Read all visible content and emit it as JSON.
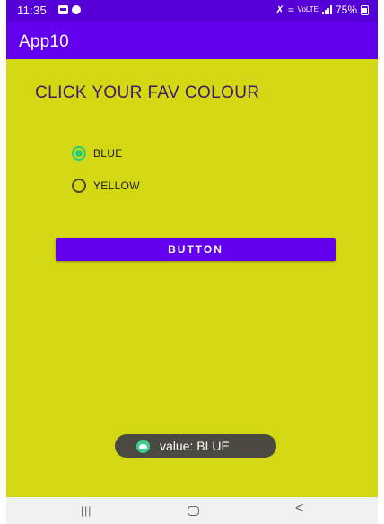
{
  "status_bar": {
    "time": "11:35",
    "signal_text": "VoLTE",
    "battery_percent": "75%"
  },
  "app_bar": {
    "title": "App10"
  },
  "main": {
    "heading": "CLICK YOUR FAV COLOUR",
    "radio_options": [
      {
        "label": "BLUE",
        "checked": true
      },
      {
        "label": "YELLOW",
        "checked": false
      }
    ],
    "button_label": "BUTTON"
  },
  "toast": {
    "message": "value: BLUE"
  },
  "nav_bar": {
    "recents_glyph": "|||",
    "back_glyph": "<"
  },
  "colors": {
    "status_bar": "#5400d6",
    "app_bar": "#6200ee",
    "background": "#d4d813",
    "radio_accent": "#1fcf7a",
    "button": "#6200ee",
    "toast": "#4a4a42"
  },
  "icons": [
    "gallery-icon",
    "notification-icon",
    "mute-icon",
    "wifi-icon",
    "signal-icon",
    "battery-icon",
    "toast-app-icon",
    "recents-icon",
    "home-icon",
    "back-icon"
  ]
}
